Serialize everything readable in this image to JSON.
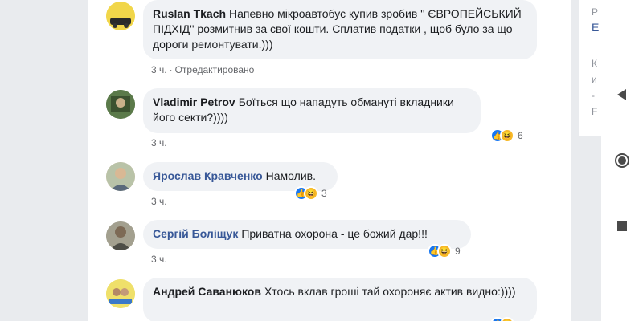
{
  "comments": [
    {
      "author": "Ruslan Tkach",
      "text": "Напевно мікроавтобус купив зробив '' ЄВРОПЕЙСЬКИЙ ПІДХІД'' розмитнив за свої кошти. Сплатив податки , щоб було за що дороги ремонтувати.)))",
      "time": "3 ч.",
      "edited": "Отредактировано"
    },
    {
      "author": "Vladimir Petrov",
      "text": "Боїться що нападуть обмануті вкладники його секти?))))",
      "time": "3 ч.",
      "reactions": "6"
    },
    {
      "author": "Ярослав Кравченко",
      "text": "Намолив.",
      "time": "3 ч.",
      "reactions": "3"
    },
    {
      "author": "Сергій Боліщук",
      "text": "Приватна охорона - це божий дар!!!",
      "time": "3 ч.",
      "reactions": "9"
    },
    {
      "author": "Андрей Саванюков",
      "text": "Хтось вклав гроші тай охороняє актив видно:))))",
      "time": "",
      "reactions": ""
    }
  ],
  "right_pane": {
    "line1": "Р",
    "line2": "Е",
    "line3": "К",
    "line4": "и",
    "line5": "-",
    "line6": "F"
  },
  "icons": {
    "back": "back-triangle-icon",
    "home": "home-circle-icon",
    "recents": "recents-square-icon"
  }
}
